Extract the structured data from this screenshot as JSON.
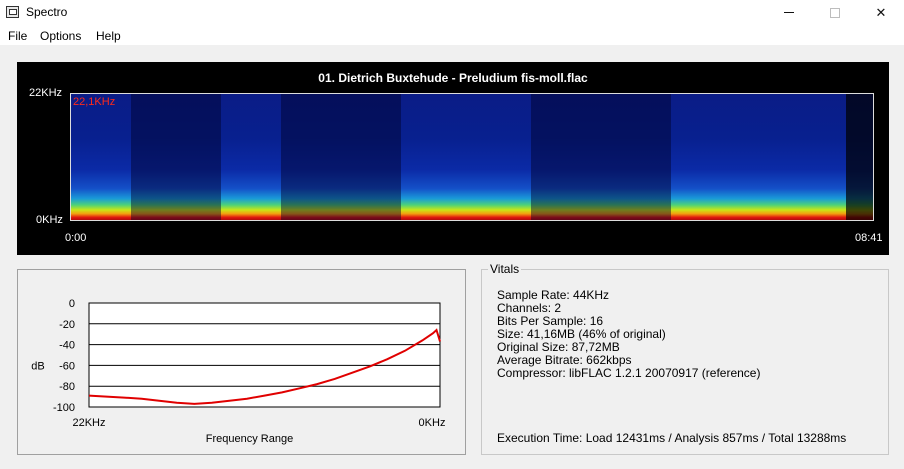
{
  "window": {
    "title": "Spectro"
  },
  "menu": {
    "items": [
      "File",
      "Options",
      "Help"
    ]
  },
  "spectrogram": {
    "title": "01. Dietrich Buxtehude - Preludium fis-moll.flac",
    "freq_top": "22KHz",
    "freq_bottom": "0KHz",
    "peak_label": "22,1KHz",
    "time_start": "0:00",
    "time_end": "08:41"
  },
  "chart_data": {
    "type": "line",
    "title": "",
    "xlabel": "Frequency Range",
    "ylabel": "dB",
    "x_tick_labels": [
      "22KHz",
      "0KHz"
    ],
    "y_ticks": [
      0,
      -20,
      -40,
      -60,
      -80,
      -100
    ],
    "ylim": [
      -100,
      0
    ],
    "grid": true,
    "series": [
      {
        "color": "#e00000",
        "x": [
          0,
          0.05,
          0.1,
          0.15,
          0.2,
          0.25,
          0.3,
          0.35,
          0.4,
          0.45,
          0.5,
          0.55,
          0.6,
          0.65,
          0.7,
          0.75,
          0.8,
          0.85,
          0.9,
          0.95,
          0.98,
          0.99,
          1.0
        ],
        "values": [
          -89,
          -90,
          -91,
          -92,
          -94,
          -96,
          -97,
          -96,
          -94,
          -92,
          -89,
          -86,
          -82,
          -78,
          -73,
          -67,
          -61,
          -54,
          -46,
          -36,
          -29,
          -26,
          -37
        ]
      }
    ]
  },
  "vitals": {
    "legend": "Vitals",
    "lines": [
      "Sample Rate: 44KHz",
      "Channels: 2",
      "Bits Per Sample: 16",
      "Size: 41,16MB (46% of original)",
      "Original Size: 87,72MB",
      "Average Bitrate: 662kbps",
      "Compressor: libFLAC 1.2.1 20070917 (reference)"
    ],
    "execution": "Execution Time: Load 12431ms / Analysis 857ms / Total 13288ms"
  }
}
